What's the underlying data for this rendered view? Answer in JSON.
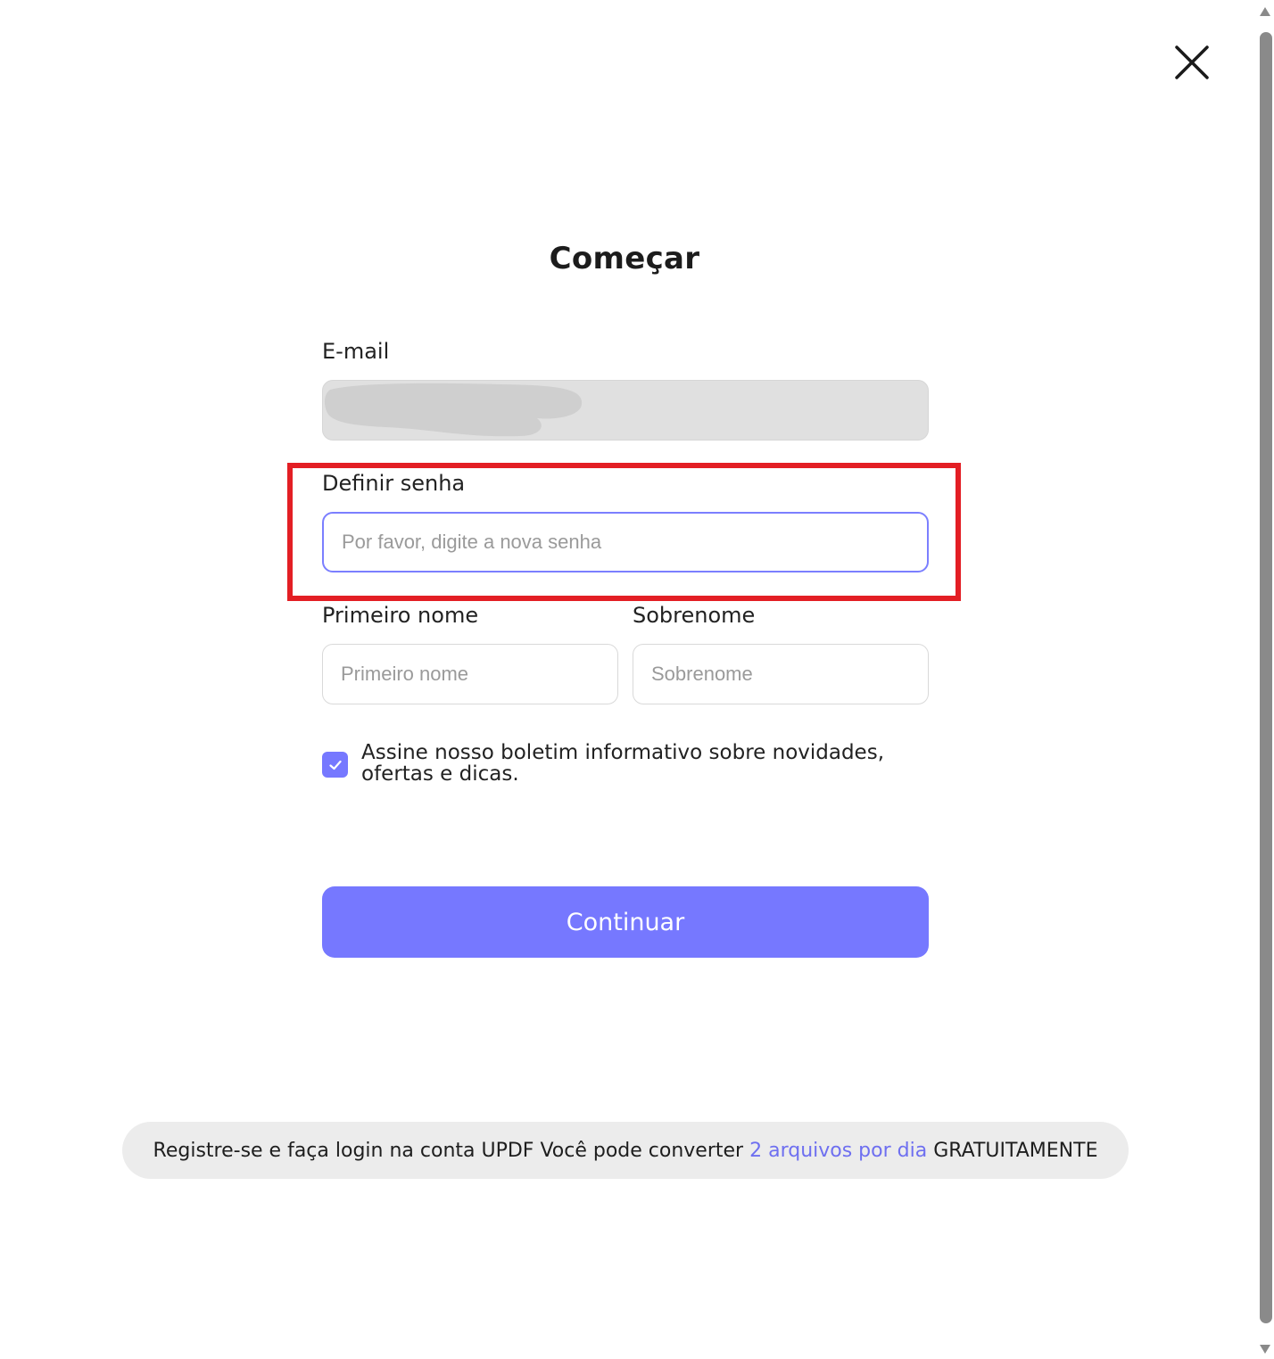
{
  "dialog": {
    "title": "Começar",
    "close_icon": "close-icon"
  },
  "form": {
    "email": {
      "label": "E-mail",
      "value": ""
    },
    "password": {
      "label": "Definir senha",
      "placeholder": "Por favor, digite a nova senha",
      "value": ""
    },
    "first_name": {
      "label": "Primeiro nome",
      "placeholder": "Primeiro nome"
    },
    "last_name": {
      "label": "Sobrenome",
      "placeholder": "Sobrenome"
    },
    "newsletter": {
      "checked": true,
      "text": "Assine nosso boletim informativo sobre novidades, ofertas e dicas."
    },
    "continue_label": "Continuar"
  },
  "promo": {
    "text_before": "Registre-se e faça login na conta UPDF Você pode converter ",
    "link_text": "2 arquivos por dia",
    "text_after": " GRATUITAMENTE"
  },
  "colors": {
    "accent": "#7678ff",
    "highlight": "#e31e24",
    "link": "#6e6ff0"
  }
}
